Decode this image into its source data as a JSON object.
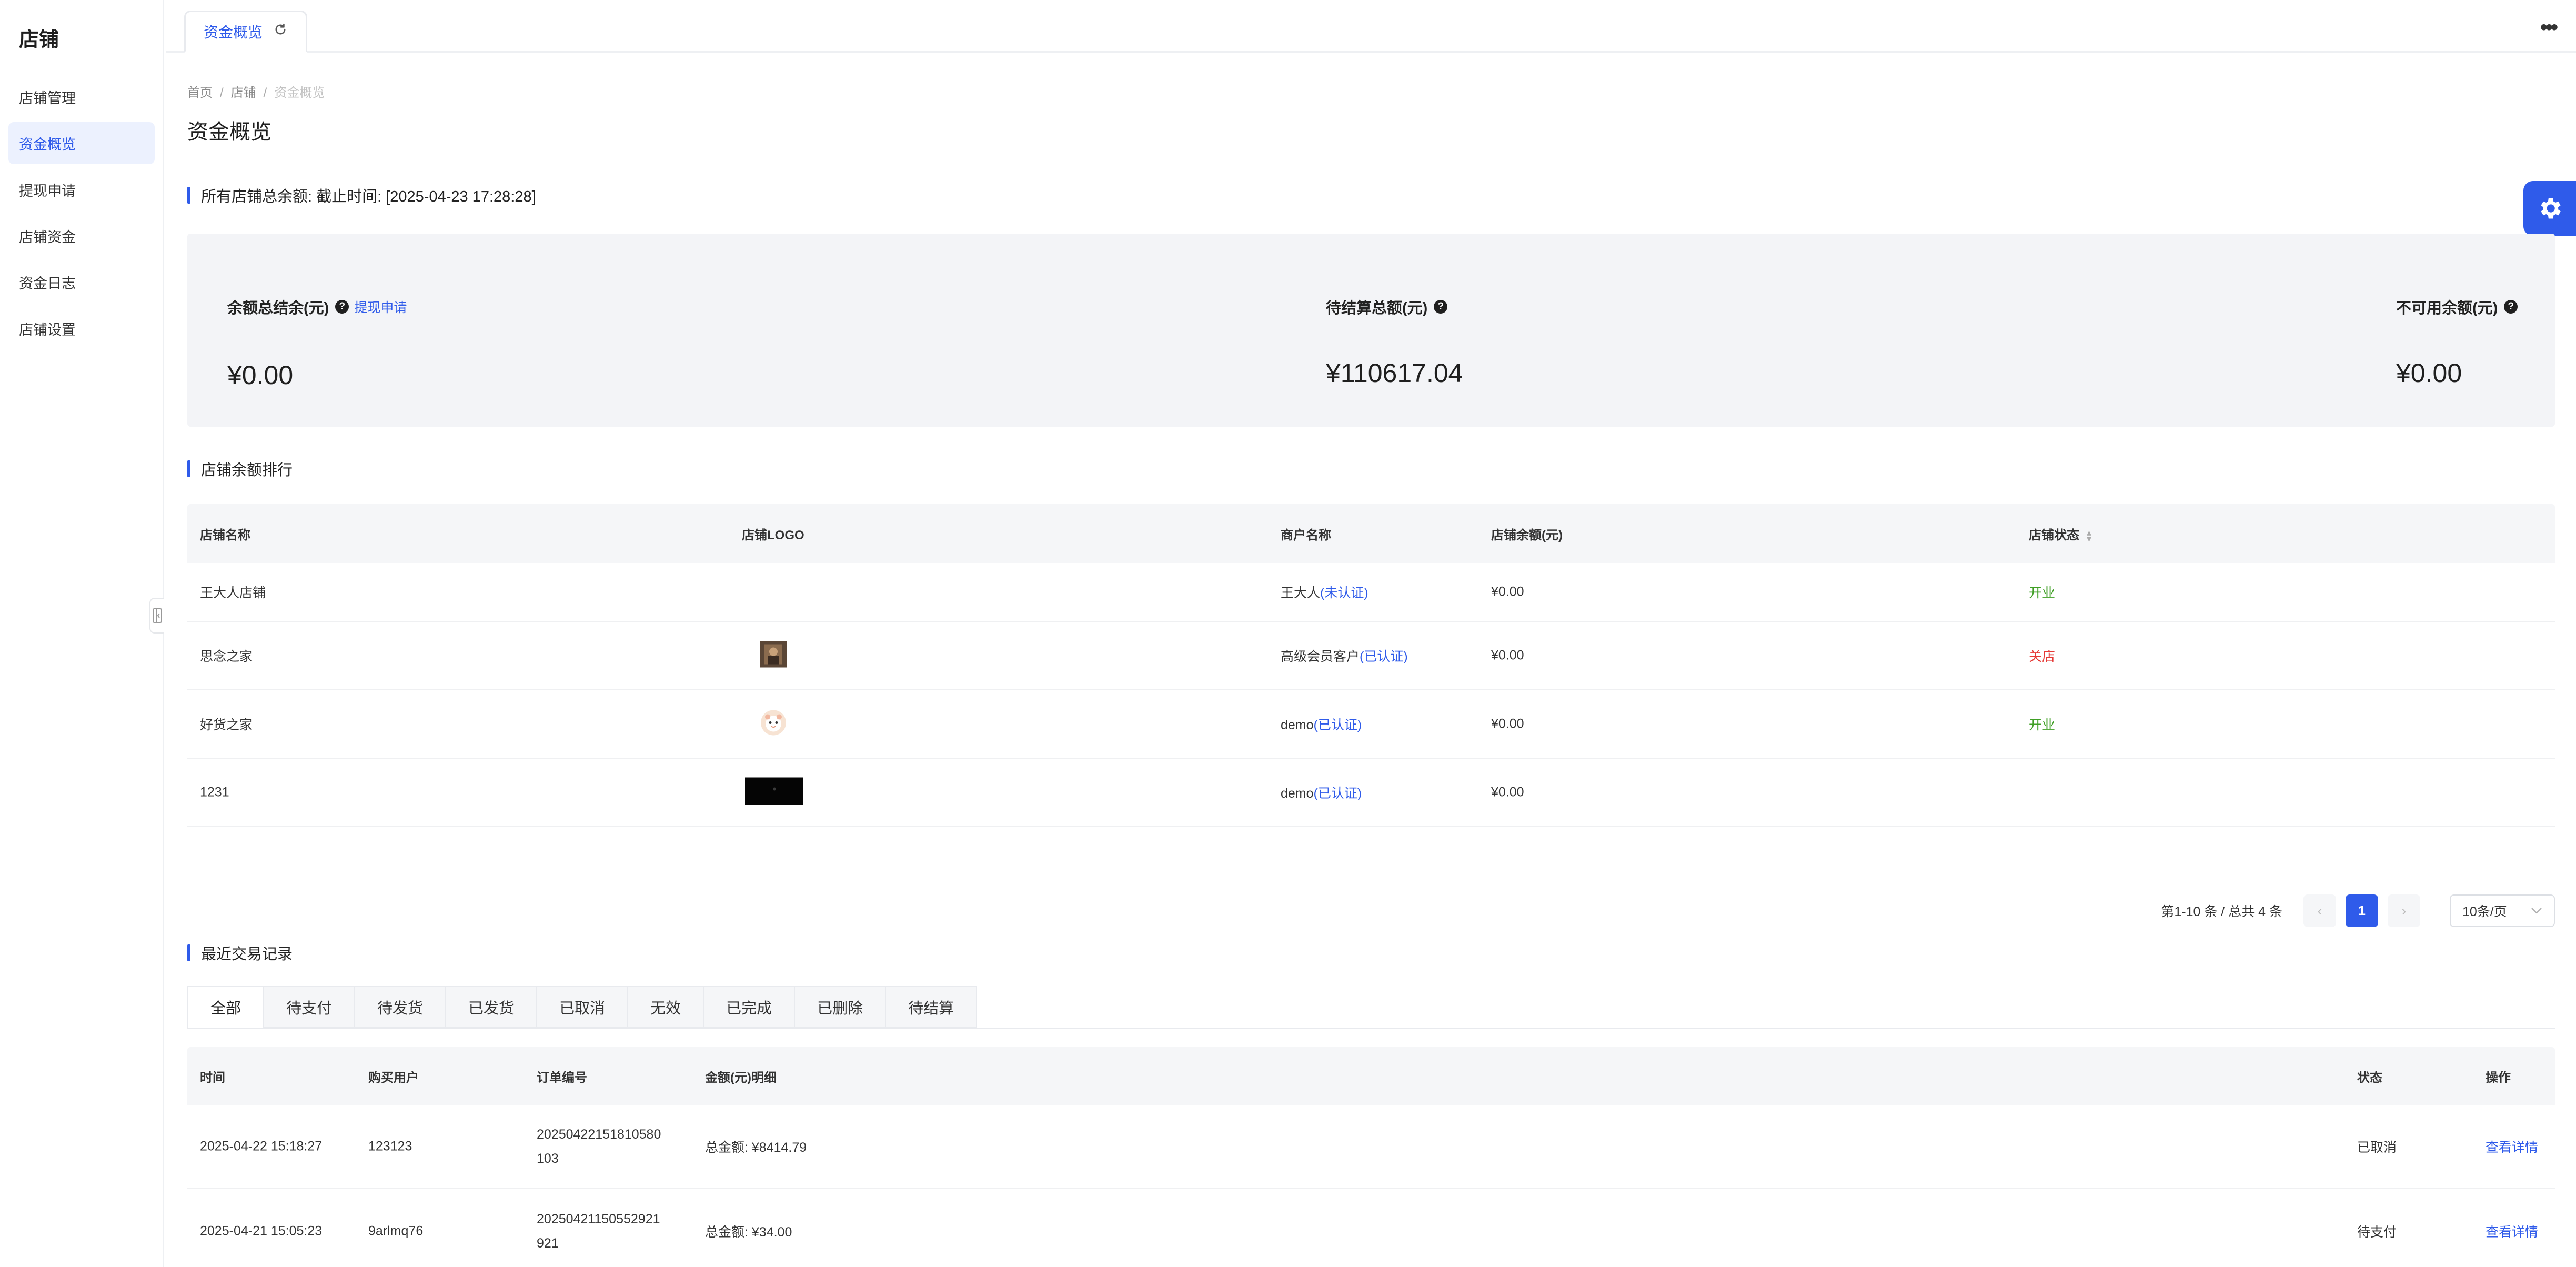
{
  "sidebar": {
    "brand": "店铺",
    "items": [
      {
        "label": "店铺管理"
      },
      {
        "label": "资金概览"
      },
      {
        "label": "提现申请"
      },
      {
        "label": "店铺资金"
      },
      {
        "label": "资金日志"
      },
      {
        "label": "店铺设置"
      }
    ],
    "active_index": 1
  },
  "tabbar": {
    "tab_label": "资金概览"
  },
  "breadcrumb": {
    "items": [
      "首页",
      "店铺",
      "资金概览"
    ],
    "separator": "/"
  },
  "page_title": "资金概览",
  "summary": {
    "section_title": "所有店铺总余额: 截止时间: [2025-04-23 17:28:28]",
    "cards": [
      {
        "label": "余额总结余(元)",
        "value": "¥0.00",
        "link": "提现申请"
      },
      {
        "label": "待结算总额(元)",
        "value": "¥110617.04"
      },
      {
        "label": "不可用余额(元)",
        "value": "¥0.00"
      }
    ]
  },
  "store_ranking": {
    "section_title": "店铺余额排行",
    "columns": [
      "店铺名称",
      "店铺LOGO",
      "商户名称",
      "店铺余额(元)",
      "店铺状态"
    ],
    "rows": [
      {
        "name": "王大人店铺",
        "logo": "",
        "merchant": "王大人",
        "verify": "(未认证)",
        "balance": "¥0.00",
        "status": "开业",
        "status_type": "open"
      },
      {
        "name": "思念之家",
        "logo": "photo-thumbnail",
        "merchant": "高级会员客户",
        "verify": "(已认证)",
        "balance": "¥0.00",
        "status": "关店",
        "status_type": "closed"
      },
      {
        "name": "好货之家",
        "logo": "cartoon-avatar",
        "merchant": "demo",
        "verify": "(已认证)",
        "balance": "¥0.00",
        "status": "开业",
        "status_type": "open"
      },
      {
        "name": "1231",
        "logo": "dark-banner",
        "merchant": "demo",
        "verify": "(已认证)",
        "balance": "¥0.00",
        "status": "",
        "status_type": "none"
      }
    ],
    "pagination": {
      "summary": "第1-10 条 / 总共 4 条",
      "current_page": "1",
      "page_size": "10条/页"
    }
  },
  "recent_orders": {
    "section_title": "最近交易记录",
    "tabs": [
      "全部",
      "待支付",
      "待发货",
      "已发货",
      "已取消",
      "无效",
      "已完成",
      "已删除",
      "待结算"
    ],
    "active_tab": 0,
    "columns": [
      "时间",
      "购买用户",
      "订单编号",
      "金额(元)明细",
      "状态",
      "操作"
    ],
    "rows": [
      {
        "time": "2025-04-22 15:18:27",
        "user": "123123",
        "order_no_1": "20250422151810580",
        "order_no_2": "103",
        "amount": "总金额: ¥8414.79",
        "status": "已取消",
        "action": "查看详情"
      },
      {
        "time": "2025-04-21 15:05:23",
        "user": "9arlmq76",
        "order_no_1": "20250421150552921",
        "order_no_2": "921",
        "amount": "总金额: ¥34.00",
        "status": "待支付",
        "action": "查看详情"
      }
    ]
  },
  "colors": {
    "accent": "#2f5bea",
    "open": "#3f9f25",
    "closed": "#e53935",
    "panel_bg": "#f3f4f7"
  }
}
